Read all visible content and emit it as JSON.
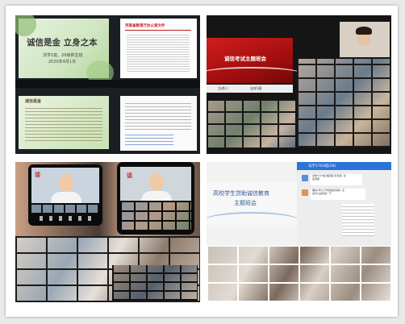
{
  "q1": {
    "slide_title": "诚信是金 立身之本",
    "slide_sub1": "法学1班、20级新生班",
    "slide_sub2": "2020年4月1日",
    "doc_title": "河南省教育厅办公室文件",
    "lower_title": "诚信是金"
  },
  "q2": {
    "banner_title": "诚信考试主题班会",
    "banner_caption_left": "主讲人：",
    "banner_caption_right": "法学1班"
  },
  "q3": {
    "phone_text": "话",
    "phone_text2": "话"
  },
  "q4": {
    "slide_title_line1": "高校学生贷助诚信教育",
    "slide_title_line2": "主题班会",
    "chat_header": "法学1703班(34)",
    "chat_msg1": "法学1703班 晚回答 安息题, 请\n生意题",
    "chat_msg2": "确切1年以下年级会向请新. 点\n最可以后有最一下"
  },
  "colors": {
    "red_banner": "#b81414",
    "chat_blue": "#2b73d6",
    "green_bg": "#bcd8a8"
  }
}
